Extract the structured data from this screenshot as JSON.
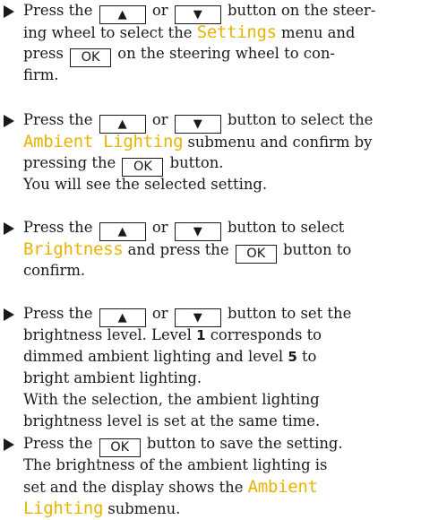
{
  "steps": [
    {
      "lines": [
        [
          "Press the ",
          "key:up",
          " or ",
          "key:down",
          " button on the steer-"
        ],
        [
          "ing wheel to select the ",
          "hl:Settings",
          " menu and"
        ],
        [
          "press ",
          "key:ok",
          " on the steering wheel to con-"
        ],
        [
          "firm."
        ]
      ]
    },
    {
      "lines": [
        [
          "Press the ",
          "key:up",
          " or ",
          "key:down",
          " button to select the"
        ],
        [
          "hl:Ambient Lighting",
          " submenu and confirm by"
        ],
        [
          "pressing the ",
          "key:ok",
          " button."
        ],
        [
          "You will see the selected setting."
        ]
      ]
    },
    {
      "lines": [
        [
          "Press the ",
          "key:up",
          " or ",
          "key:down",
          " button to select"
        ],
        [
          "hl:Brightness",
          " and press the ",
          "key:ok",
          " button to"
        ],
        [
          "confirm."
        ]
      ]
    },
    {
      "lines": [
        [
          "Press the ",
          "key:up",
          " or ",
          "key:down",
          " button to set the"
        ],
        [
          "brightness level. Level ",
          "b:1",
          " corresponds to"
        ],
        [
          "dimmed ambient lighting and level ",
          "b:5",
          " to"
        ],
        [
          "bright ambient lighting."
        ],
        [
          "With the selection, the ambient lighting"
        ],
        [
          "brightness level is set at the same time."
        ]
      ]
    },
    {
      "lines": [
        [
          "Press the ",
          "key:ok",
          " button to save the setting."
        ],
        [
          "The brightness of the ambient lighting is"
        ],
        [
          "set and the display shows the ",
          "hl:Ambient"
        ],
        [
          "hl:Lighting",
          " submenu."
        ]
      ]
    }
  ],
  "keys": {
    "up": "▲",
    "down": "▼",
    "ok": "OK"
  },
  "colors": {
    "highlight": "#e8b400",
    "text": "#1a1a1a"
  }
}
